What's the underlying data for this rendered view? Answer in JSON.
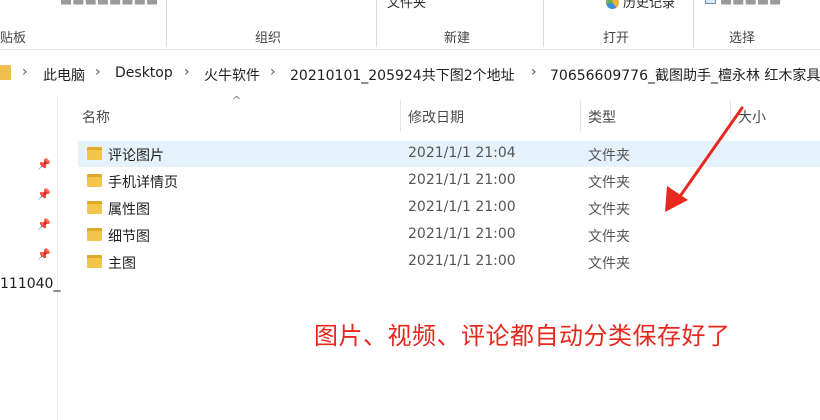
{
  "ribbon": {
    "partial_top_left": "■■■■■■■■",
    "folder_top": "文件夹",
    "history": "历史记录",
    "select_top": "■■■■■",
    "groups": [
      "贴板",
      "组织",
      "新建",
      "打开",
      "选择"
    ]
  },
  "breadcrumb": [
    "此电脑",
    "Desktop",
    "火牛软件",
    "20210101_205924共下图2个地址",
    "70656609776_截图助手_檀永林 红木家具"
  ],
  "nav": {
    "truncated_item": "111040_"
  },
  "columns": [
    "名称",
    "修改日期",
    "类型",
    "大小"
  ],
  "rows": [
    {
      "name": "评论图片",
      "date": "2021/1/1 21:04",
      "type": "文件夹",
      "selected": true
    },
    {
      "name": "手机详情页",
      "date": "2021/1/1 21:00",
      "type": "文件夹",
      "selected": false
    },
    {
      "name": "属性图",
      "date": "2021/1/1 21:00",
      "type": "文件夹",
      "selected": false
    },
    {
      "name": "细节图",
      "date": "2021/1/1 21:00",
      "type": "文件夹",
      "selected": false
    },
    {
      "name": "主图",
      "date": "2021/1/1 21:00",
      "type": "文件夹",
      "selected": false
    }
  ],
  "annotation": "图片、视频、评论都自动分类保存好了",
  "colors": {
    "annotation": "#e8281e",
    "selected_row": "#e5f1fb",
    "folder": "#f2c54c"
  }
}
